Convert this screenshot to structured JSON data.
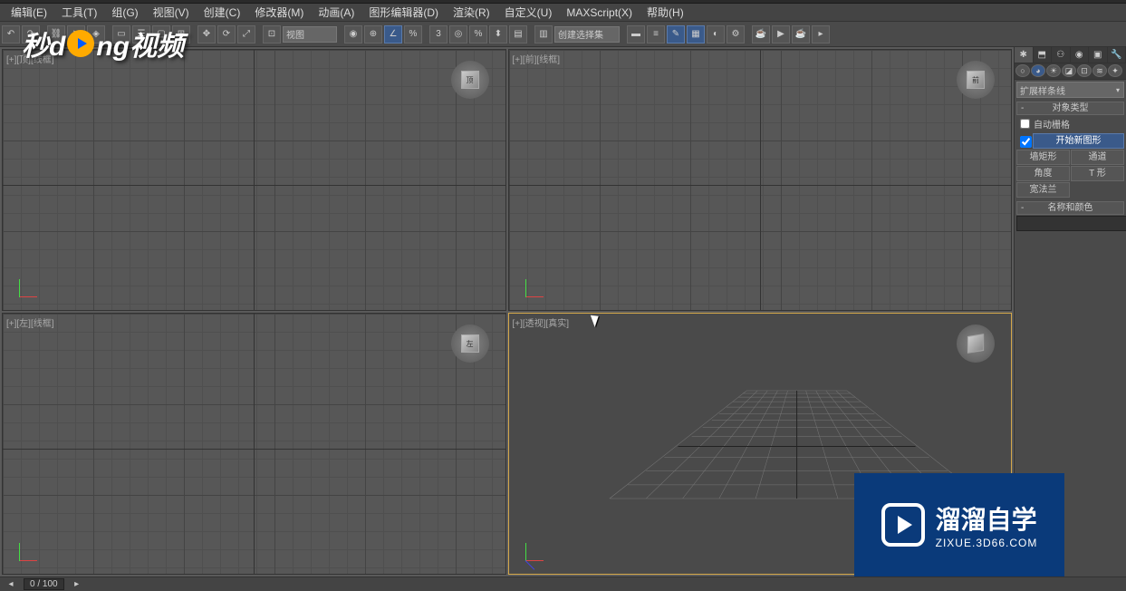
{
  "menu": {
    "edit": "编辑(E)",
    "tools": "工具(T)",
    "group": "组(G)",
    "view": "视图(V)",
    "create": "创建(C)",
    "modifiers": "修改器(M)",
    "animation": "动画(A)",
    "graph": "图形编辑器(D)",
    "render": "渲染(R)",
    "customize": "自定义(U)",
    "maxscript": "MAXScript(X)",
    "help": "帮助(H)"
  },
  "toolbar": {
    "view_dropdown": "视图",
    "select_dropdown": "创建选择集"
  },
  "viewports": {
    "top": "[+][顶][线框]",
    "front": "[+][前][线框]",
    "left": "[+][左][线框]",
    "persp": "[+][透视][真实]",
    "cube_top": "顶",
    "cube_front": "前",
    "cube_left": "左"
  },
  "panel": {
    "category_dropdown": "扩展样条线",
    "section_object_type": "对象类型",
    "auto_grid": "自动栅格",
    "start_new_shape": "开始新图形",
    "btn_wall_rect": "墙矩形",
    "btn_channel": "通道",
    "btn_angle": "角度",
    "btn_tee": "T 形",
    "btn_wide_flange": "宽法兰",
    "section_name_color": "名称和颜色"
  },
  "status": {
    "frame": "0 / 100"
  },
  "logo": {
    "part1": "秒d",
    "part2": "ng视频"
  },
  "watermark": {
    "main": "溜溜自学",
    "sub": "ZIXUE.3D66.COM"
  }
}
